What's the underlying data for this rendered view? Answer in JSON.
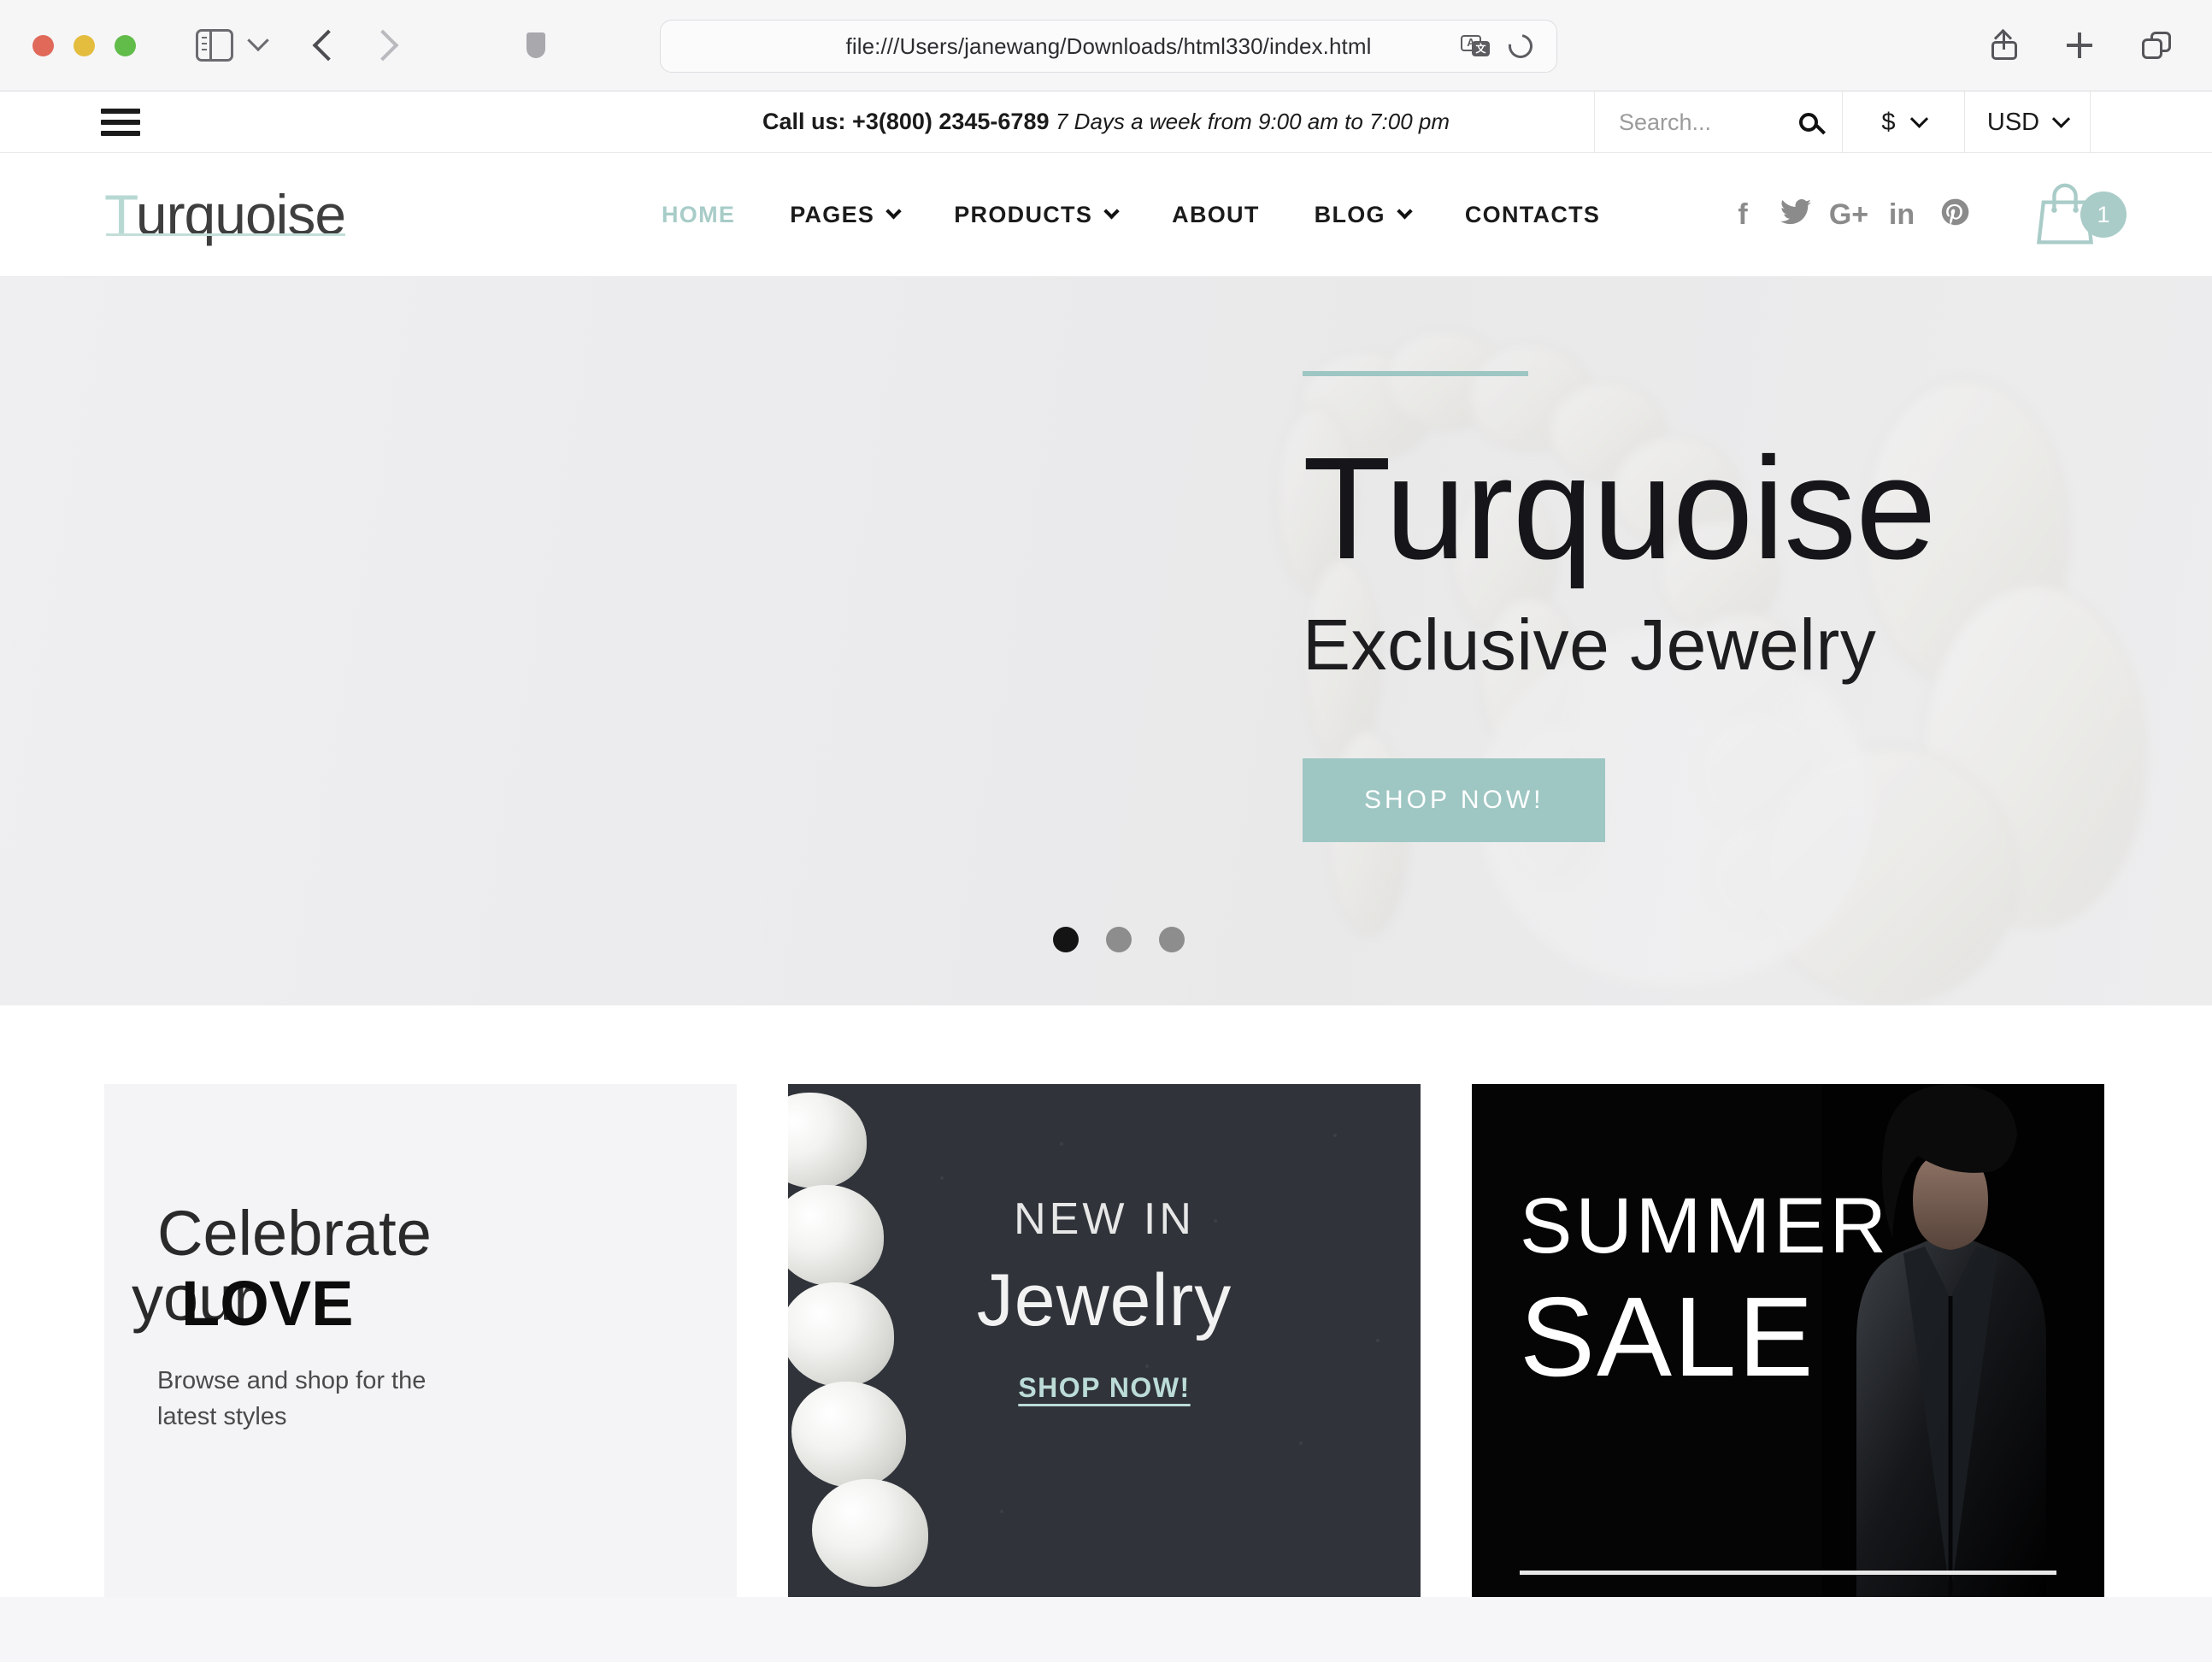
{
  "browser": {
    "url": "file:///Users/janewang/Downloads/html330/index.html",
    "icons": {
      "sidebar": "sidebar-icon",
      "back": "back-arrow-icon",
      "forward": "forward-arrow-icon",
      "shield": "privacy-shield-icon",
      "translate": "translate-icon",
      "reload": "reload-icon",
      "share": "share-icon",
      "new_tab": "plus-icon",
      "tab_overview": "tab-overview-icon"
    },
    "translate_glyph_a": "A",
    "translate_glyph_b": "文"
  },
  "topbar": {
    "menu_icon": "hamburger-menu-icon",
    "call_label": "Call us:",
    "phone": "+3(800) 2345-6789",
    "hours": "7 Days a week from 9:00 am to 7:00 pm",
    "search_placeholder": "Search...",
    "search_value": "",
    "currency_symbol": "$",
    "currency_code": "USD"
  },
  "header": {
    "logo_first": "T",
    "logo_rest": "urquoise",
    "nav": [
      {
        "label": "HOME",
        "active": true,
        "caret": false
      },
      {
        "label": "PAGES",
        "active": false,
        "caret": true
      },
      {
        "label": "PRODUCTS",
        "active": false,
        "caret": true
      },
      {
        "label": "ABOUT",
        "active": false,
        "caret": false
      },
      {
        "label": "BLOG",
        "active": false,
        "caret": true
      },
      {
        "label": "CONTACTS",
        "active": false,
        "caret": false
      }
    ],
    "social": [
      {
        "name": "facebook",
        "glyph": "f"
      },
      {
        "name": "twitter",
        "glyph": ""
      },
      {
        "name": "google-plus",
        "glyph": "G+"
      },
      {
        "name": "linkedin",
        "glyph": "in"
      },
      {
        "name": "pinterest",
        "glyph": ""
      }
    ],
    "cart_count": "1",
    "accent": "#a9ccc8"
  },
  "hero": {
    "title": "Turquoise",
    "subtitle": "Exclusive Jewelry",
    "cta": "SHOP NOW!",
    "accent": "#9ec6c3",
    "slides": 3,
    "active_slide": 1
  },
  "promos": [
    {
      "id": "celebrate-love",
      "line1": "Celebrate",
      "line2": "your",
      "line3": "LOVE",
      "desc_line1": "Browse and shop for the",
      "desc_line2": "latest styles"
    },
    {
      "id": "new-in-jewelry",
      "line1": "NEW IN",
      "line2": "Jewelry",
      "link": "SHOP NOW!"
    },
    {
      "id": "summer-sale",
      "line1": "SUMMER",
      "line2": "SALE"
    }
  ]
}
